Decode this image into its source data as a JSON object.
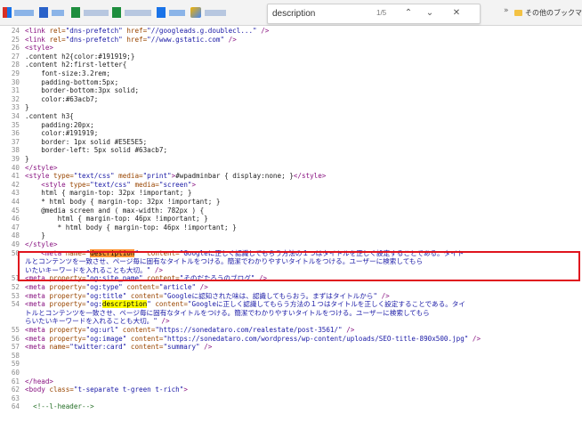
{
  "findbar": {
    "query": "description",
    "count": "1/5",
    "prev_icon": "chevron-up-icon",
    "next_icon": "chevron-down-icon",
    "close_icon": "close-icon"
  },
  "bookmarks": {
    "overflow": "»",
    "other_label": "その他のブックマ"
  },
  "colors": {
    "find_match_current": "#ff9632",
    "find_match_other": "#ffff00",
    "highlight_box": "#e0141e"
  },
  "lines": [
    {
      "n": "24",
      "parts": [
        [
          "t",
          "<link "
        ],
        [
          "a",
          "rel="
        ],
        [
          "v",
          "\"dns-prefetch\" "
        ],
        [
          "a",
          "href="
        ],
        [
          "v",
          "\"//googleads.g.doublecl...\""
        ],
        [
          "t",
          " />"
        ]
      ]
    },
    {
      "n": "25",
      "parts": [
        [
          "t",
          "<link "
        ],
        [
          "a",
          "rel="
        ],
        [
          "v",
          "\"dns-prefetch\" "
        ],
        [
          "a",
          "href="
        ],
        [
          "v",
          "\"//www.gstatic.com\""
        ],
        [
          "t",
          " />"
        ]
      ]
    },
    {
      "n": "26",
      "parts": [
        [
          "t",
          "<style>"
        ]
      ]
    },
    {
      "n": "27",
      "parts": [
        [
          "p",
          ".content h2{color:#191919;}"
        ]
      ]
    },
    {
      "n": "28",
      "parts": [
        [
          "p",
          ".content h2:first-letter{"
        ]
      ]
    },
    {
      "n": "29",
      "parts": [
        [
          "p",
          "    font-size:3.2rem;"
        ]
      ]
    },
    {
      "n": "30",
      "parts": [
        [
          "p",
          "    padding-bottom:5px;"
        ]
      ]
    },
    {
      "n": "31",
      "parts": [
        [
          "p",
          "    border-bottom:3px solid;"
        ]
      ]
    },
    {
      "n": "32",
      "parts": [
        [
          "p",
          "    color:#63acb7;"
        ]
      ]
    },
    {
      "n": "33",
      "parts": [
        [
          "p",
          "}"
        ]
      ]
    },
    {
      "n": "34",
      "parts": [
        [
          "p",
          ".content h3{"
        ]
      ]
    },
    {
      "n": "35",
      "parts": [
        [
          "p",
          "    padding:20px;"
        ]
      ]
    },
    {
      "n": "36",
      "parts": [
        [
          "p",
          "    color:#191919;"
        ]
      ]
    },
    {
      "n": "37",
      "parts": [
        [
          "p",
          "    border: 1px solid #E5E5E5;"
        ]
      ]
    },
    {
      "n": "38",
      "parts": [
        [
          "p",
          "    border-left: 5px solid #63acb7;"
        ]
      ]
    },
    {
      "n": "39",
      "parts": [
        [
          "p",
          "}"
        ]
      ]
    },
    {
      "n": "40",
      "parts": [
        [
          "t",
          "</style>"
        ]
      ]
    },
    {
      "n": "41",
      "parts": [
        [
          "t",
          "<style "
        ],
        [
          "a",
          "type="
        ],
        [
          "v",
          "\"text/css\" "
        ],
        [
          "a",
          "media="
        ],
        [
          "v",
          "\"print\""
        ],
        [
          "t",
          ">"
        ],
        [
          "p",
          "#wpadminbar { display:none; }"
        ],
        [
          "t",
          "</style>"
        ]
      ]
    },
    {
      "n": "42",
      "parts": [
        [
          "t",
          "    <style "
        ],
        [
          "a",
          "type="
        ],
        [
          "v",
          "\"text/css\" "
        ],
        [
          "a",
          "media="
        ],
        [
          "v",
          "\"screen\""
        ],
        [
          "t",
          ">"
        ]
      ]
    },
    {
      "n": "43",
      "parts": [
        [
          "p",
          "    html { margin-top: 32px !important; }"
        ]
      ]
    },
    {
      "n": "44",
      "parts": [
        [
          "p",
          "    * html body { margin-top: 32px !important; }"
        ]
      ]
    },
    {
      "n": "45",
      "parts": [
        [
          "p",
          "    @media screen and ( max-width: 782px ) {"
        ]
      ]
    },
    {
      "n": "46",
      "parts": [
        [
          "p",
          "        html { margin-top: 46px !important; }"
        ]
      ]
    },
    {
      "n": "47",
      "parts": [
        [
          "p",
          "        * html body { margin-top: 46px !important; }"
        ]
      ]
    },
    {
      "n": "48",
      "parts": [
        [
          "p",
          "    }"
        ]
      ]
    },
    {
      "n": "49",
      "parts": [
        [
          "t",
          "</style>"
        ]
      ]
    },
    {
      "n": "50",
      "parts": [
        [
          "t",
          "    <meta "
        ],
        [
          "a",
          "name="
        ],
        [
          "v",
          "\""
        ],
        [
          "hl",
          "description"
        ],
        [
          "v",
          "\"  "
        ],
        [
          "a",
          "content="
        ],
        [
          "v",
          "\"Googleに正しく認識してもらう方法の１つはタイトルを正しく設定することである。タイト"
        ]
      ]
    },
    {
      "n": "",
      "parts": [
        [
          "v",
          "ルとコンテンツを一致させ、ページ毎に固有なタイトルをつける。簡潔でわかりやすいタイトルをつける。ユーザーに検索してもら"
        ]
      ]
    },
    {
      "n": "",
      "parts": [
        [
          "v",
          "いたいキーワードを入れることも大切。\""
        ],
        [
          "t",
          " />"
        ]
      ]
    },
    {
      "n": "51",
      "parts": [
        [
          "t",
          "<meta "
        ],
        [
          "a",
          "property="
        ],
        [
          "v",
          "\"og:site_name\" "
        ],
        [
          "a",
          "content="
        ],
        [
          "v",
          "\"そのだたろうのブログ\""
        ],
        [
          "t",
          " />"
        ]
      ]
    },
    {
      "n": "52",
      "parts": [
        [
          "t",
          "<meta "
        ],
        [
          "a",
          "property="
        ],
        [
          "v",
          "\"og:type\" "
        ],
        [
          "a",
          "content="
        ],
        [
          "v",
          "\"article\""
        ],
        [
          "t",
          " />"
        ]
      ]
    },
    {
      "n": "53",
      "parts": [
        [
          "t",
          "<meta "
        ],
        [
          "a",
          "property="
        ],
        [
          "v",
          "\"og:title\" "
        ],
        [
          "a",
          "content="
        ],
        [
          "v",
          "\"Googleに認知された味は、認識してもらおう。まずはタイトルから\""
        ],
        [
          "t",
          " />"
        ]
      ]
    },
    {
      "n": "54",
      "parts": [
        [
          "t",
          "<meta "
        ],
        [
          "a",
          "property="
        ],
        [
          "v",
          "\"og:"
        ],
        [
          "hl2",
          "description"
        ],
        [
          "v",
          "\" "
        ],
        [
          "a",
          "content="
        ],
        [
          "v",
          "\"Googleに正しく認識してもらう方法の１つはタイトルを正しく設定することである。タイ"
        ]
      ]
    },
    {
      "n": "",
      "parts": [
        [
          "v",
          "トルとコンテンツを一致させ、ページ毎に固有なタイトルをつける。簡潔でわかりやすいタイトルをつける。ユーザーに検索してもら"
        ]
      ]
    },
    {
      "n": "",
      "parts": [
        [
          "v",
          "らいたいキーワードを入れることも大切。\""
        ],
        [
          "t",
          " />"
        ]
      ]
    },
    {
      "n": "55",
      "parts": [
        [
          "t",
          "<meta "
        ],
        [
          "a",
          "property="
        ],
        [
          "v",
          "\"og:url\" "
        ],
        [
          "a",
          "content="
        ],
        [
          "v",
          "\"https://sonedataro.com/realestate/post-3561/\""
        ],
        [
          "t",
          " />"
        ]
      ]
    },
    {
      "n": "56",
      "parts": [
        [
          "t",
          "<meta "
        ],
        [
          "a",
          "property="
        ],
        [
          "v",
          "\"og:image\" "
        ],
        [
          "a",
          "content="
        ],
        [
          "v",
          "\"https://sonedataro.com/wordpress/wp-content/uploads/SEO-title-890x500.jpg\""
        ],
        [
          "t",
          " />"
        ]
      ]
    },
    {
      "n": "57",
      "parts": [
        [
          "t",
          "<meta "
        ],
        [
          "a",
          "name="
        ],
        [
          "v",
          "\"twitter:card\" "
        ],
        [
          "a",
          "content="
        ],
        [
          "v",
          "\"summary\""
        ],
        [
          "t",
          " />"
        ]
      ]
    },
    {
      "n": "58",
      "parts": []
    },
    {
      "n": "59",
      "parts": []
    },
    {
      "n": "60",
      "parts": []
    },
    {
      "n": "61",
      "parts": [
        [
          "t",
          "</head>"
        ]
      ]
    },
    {
      "n": "62",
      "parts": [
        [
          "t",
          "<body "
        ],
        [
          "a",
          "class="
        ],
        [
          "v",
          "\"t-separate t-green t-rich\""
        ],
        [
          "t",
          ">"
        ]
      ]
    },
    {
      "n": "63",
      "parts": []
    },
    {
      "n": "64",
      "parts": [
        [
          "c",
          "  <!--l-header-->"
        ]
      ]
    }
  ]
}
